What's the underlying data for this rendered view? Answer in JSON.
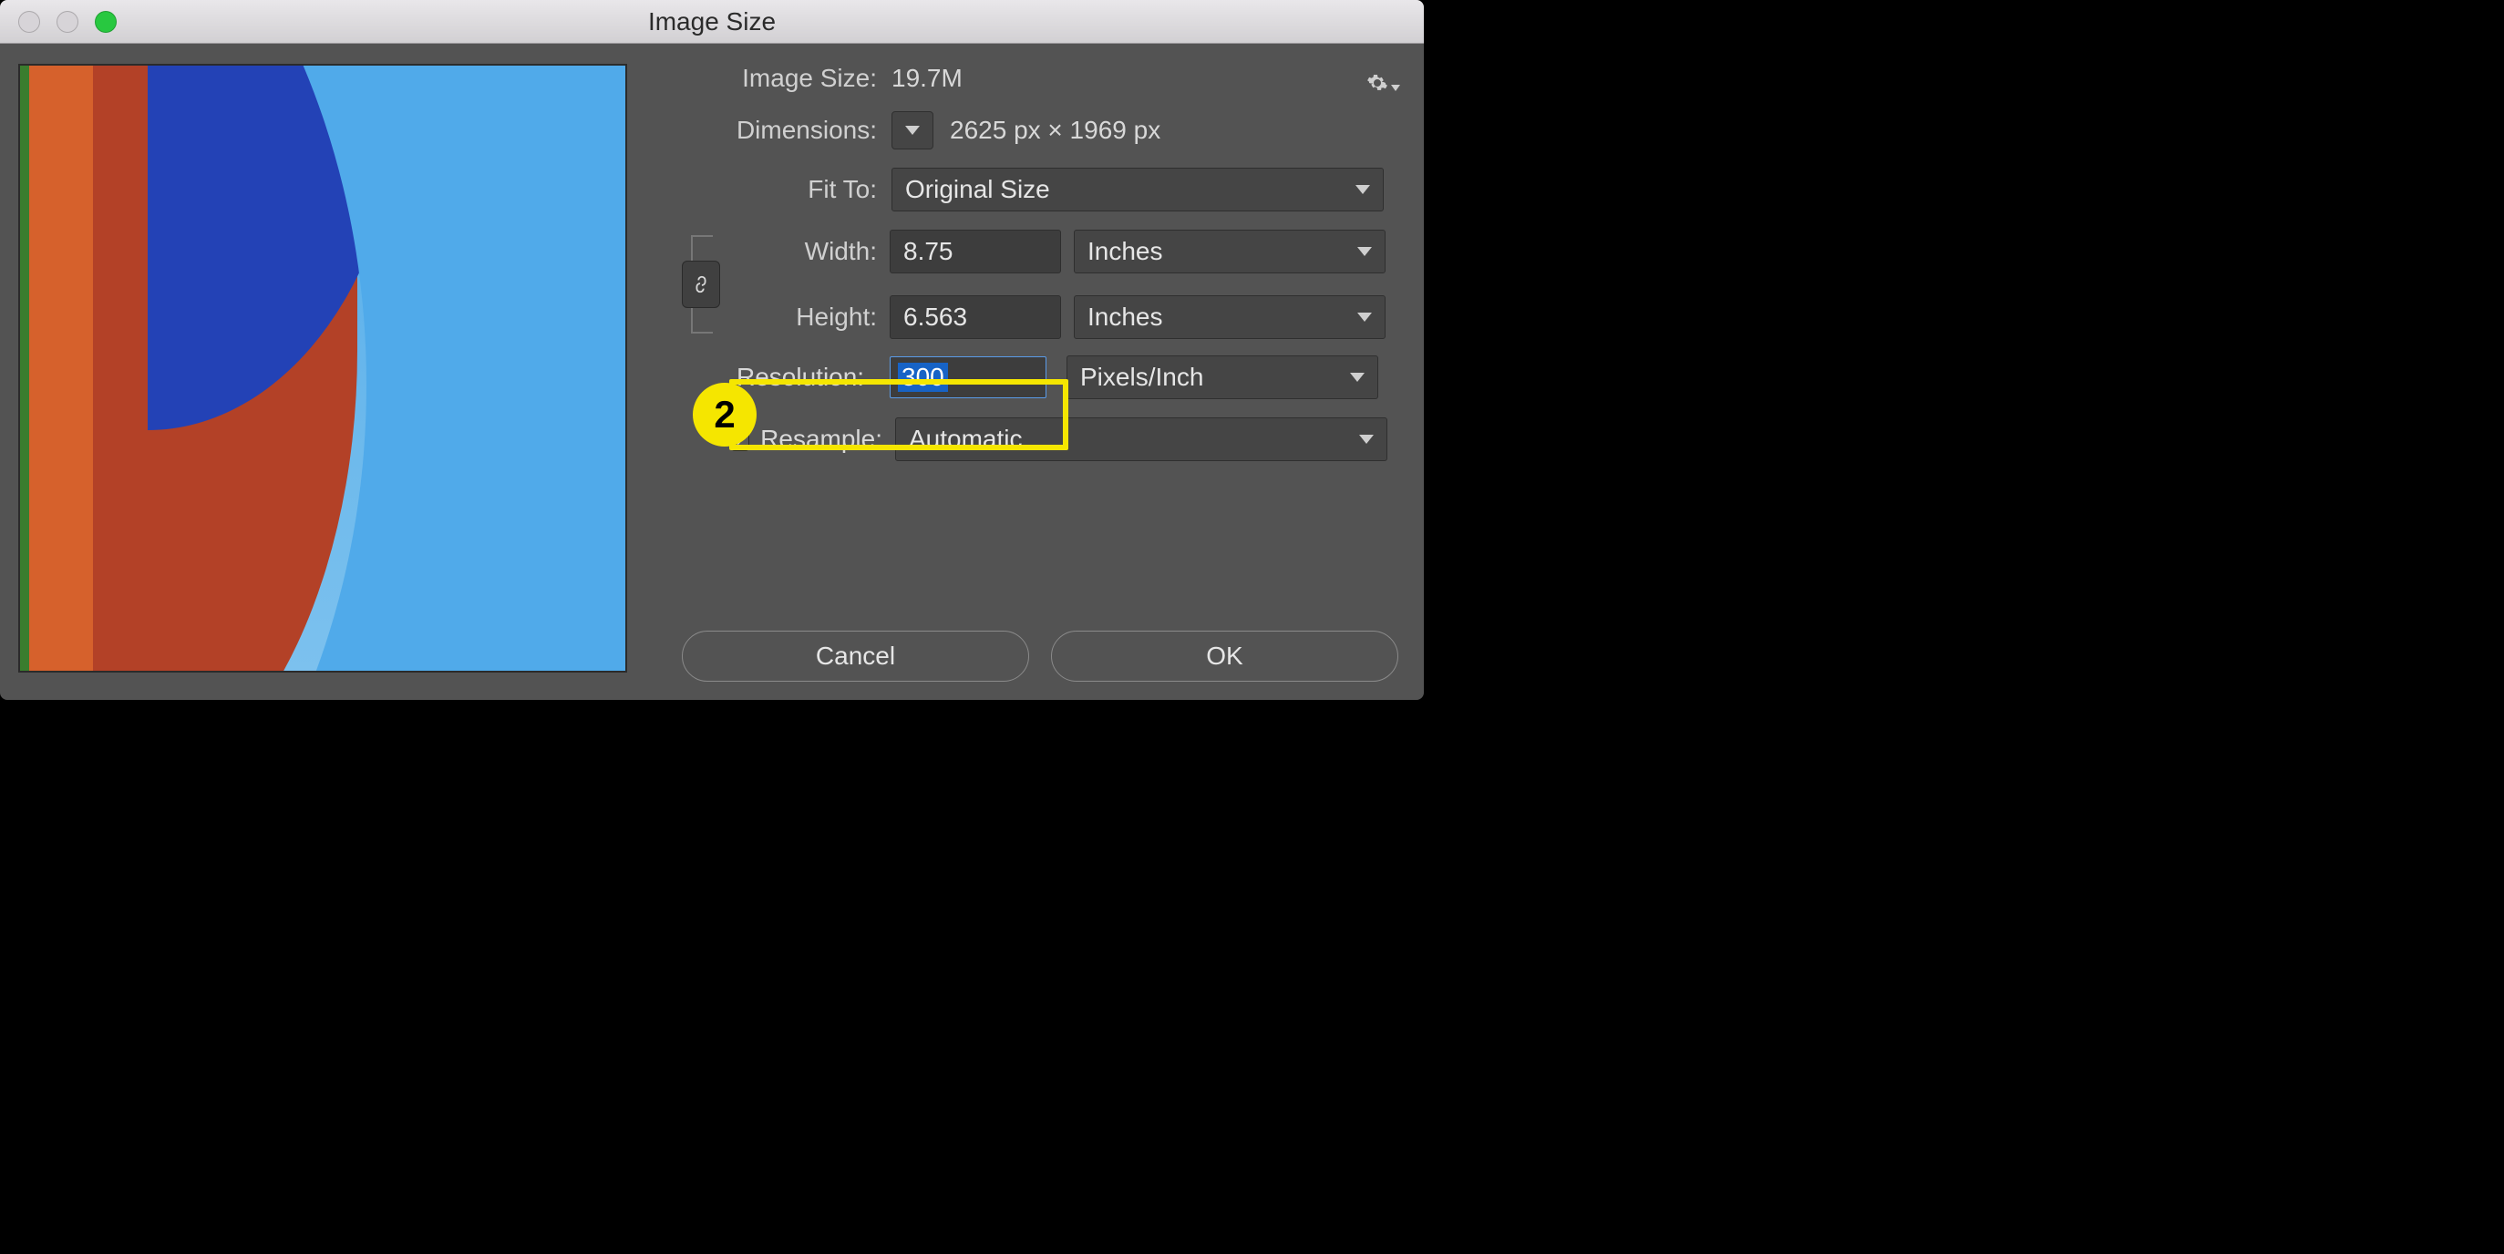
{
  "window": {
    "title": "Image Size"
  },
  "info": {
    "image_size_label": "Image Size:",
    "image_size_value": "19.7M",
    "dimensions_label": "Dimensions:",
    "dimensions_value": "2625 px  ×  1969 px"
  },
  "fit_to": {
    "label": "Fit To:",
    "value": "Original Size"
  },
  "width": {
    "label": "Width:",
    "value": "8.75",
    "unit": "Inches"
  },
  "height": {
    "label": "Height:",
    "value": "6.563",
    "unit": "Inches"
  },
  "resolution": {
    "label": "Resolution:",
    "value": "300",
    "unit": "Pixels/Inch"
  },
  "resample": {
    "label": "Resample:",
    "checked": true,
    "value": "Automatic"
  },
  "buttons": {
    "cancel": "Cancel",
    "ok": "OK"
  },
  "callout": {
    "number": "2"
  },
  "icons": {
    "gear": "gear-icon",
    "chevron_down": "chevron-down-icon",
    "link": "link-icon",
    "check": "check-icon"
  }
}
